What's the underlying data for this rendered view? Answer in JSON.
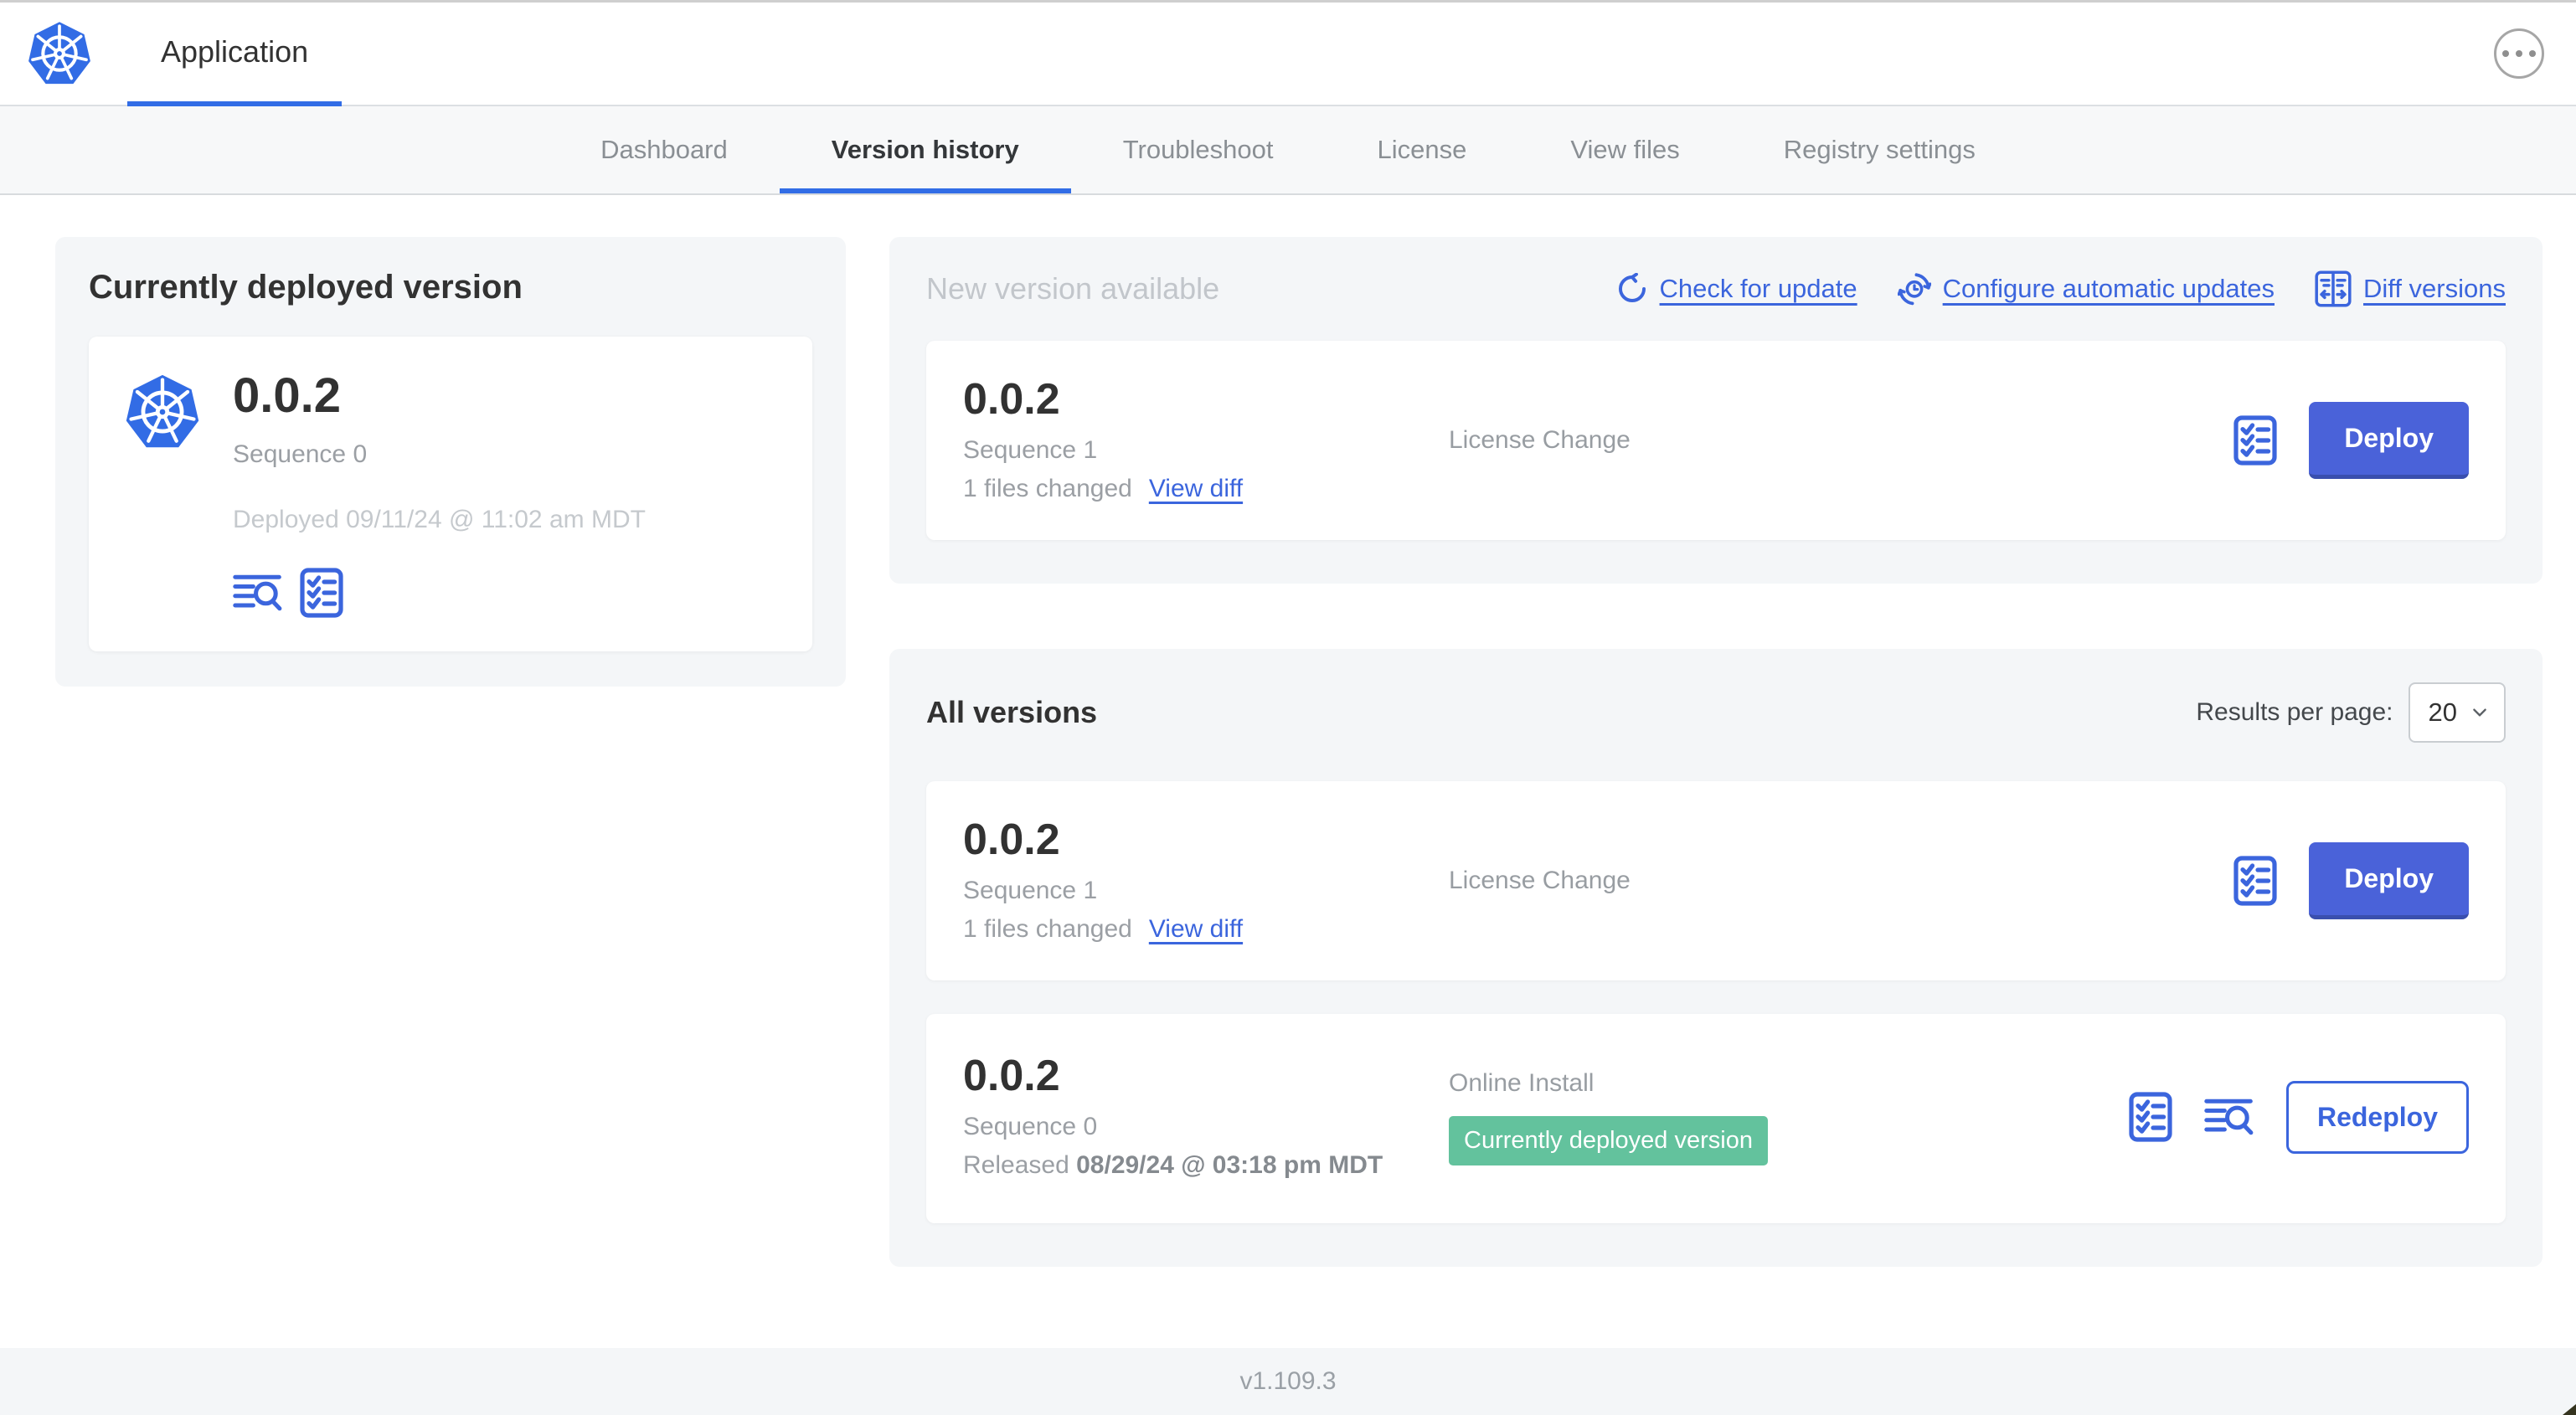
{
  "header": {
    "app_label": "Application"
  },
  "nav": {
    "active_tab": "Version history",
    "tabs": [
      {
        "label": "Dashboard"
      },
      {
        "label": "Version history"
      },
      {
        "label": "Troubleshoot"
      },
      {
        "label": "License"
      },
      {
        "label": "View files"
      },
      {
        "label": "Registry settings"
      }
    ]
  },
  "current": {
    "title": "Currently deployed version",
    "version": "0.0.2",
    "sequence": "Sequence 0",
    "deployed": "Deployed 09/11/24 @ 11:02 am MDT"
  },
  "new_version": {
    "title": "New version available",
    "links": {
      "check": "Check for update",
      "auto": "Configure automatic updates",
      "diff": "Diff versions"
    },
    "card": {
      "version": "0.0.2",
      "sequence": "Sequence 1",
      "files_changed": "1 files changed",
      "view_diff": "View diff",
      "source": "License Change",
      "action": "Deploy"
    }
  },
  "all_versions": {
    "title": "All versions",
    "per_page_label": "Results per page:",
    "per_page_value": "20",
    "rows": [
      {
        "version": "0.0.2",
        "sequence": "Sequence 1",
        "files_changed": "1 files changed",
        "view_diff": "View diff",
        "source": "License Change",
        "action": "Deploy"
      },
      {
        "version": "0.0.2",
        "sequence": "Sequence 0",
        "released_label": "Released",
        "released_date": "08/29/24 @ 03:18 pm MDT",
        "source": "Online Install",
        "badge": "Currently deployed version",
        "action": "Redeploy"
      }
    ]
  },
  "footer": {
    "app_version": "v1.109.3"
  },
  "colors": {
    "primary_blue": "#3b65dd",
    "k8s_blue": "#326ce5",
    "deploy_button_blue": "#4a62d9",
    "badge_green": "#63c29d",
    "section_gray": "#f4f6f8"
  }
}
